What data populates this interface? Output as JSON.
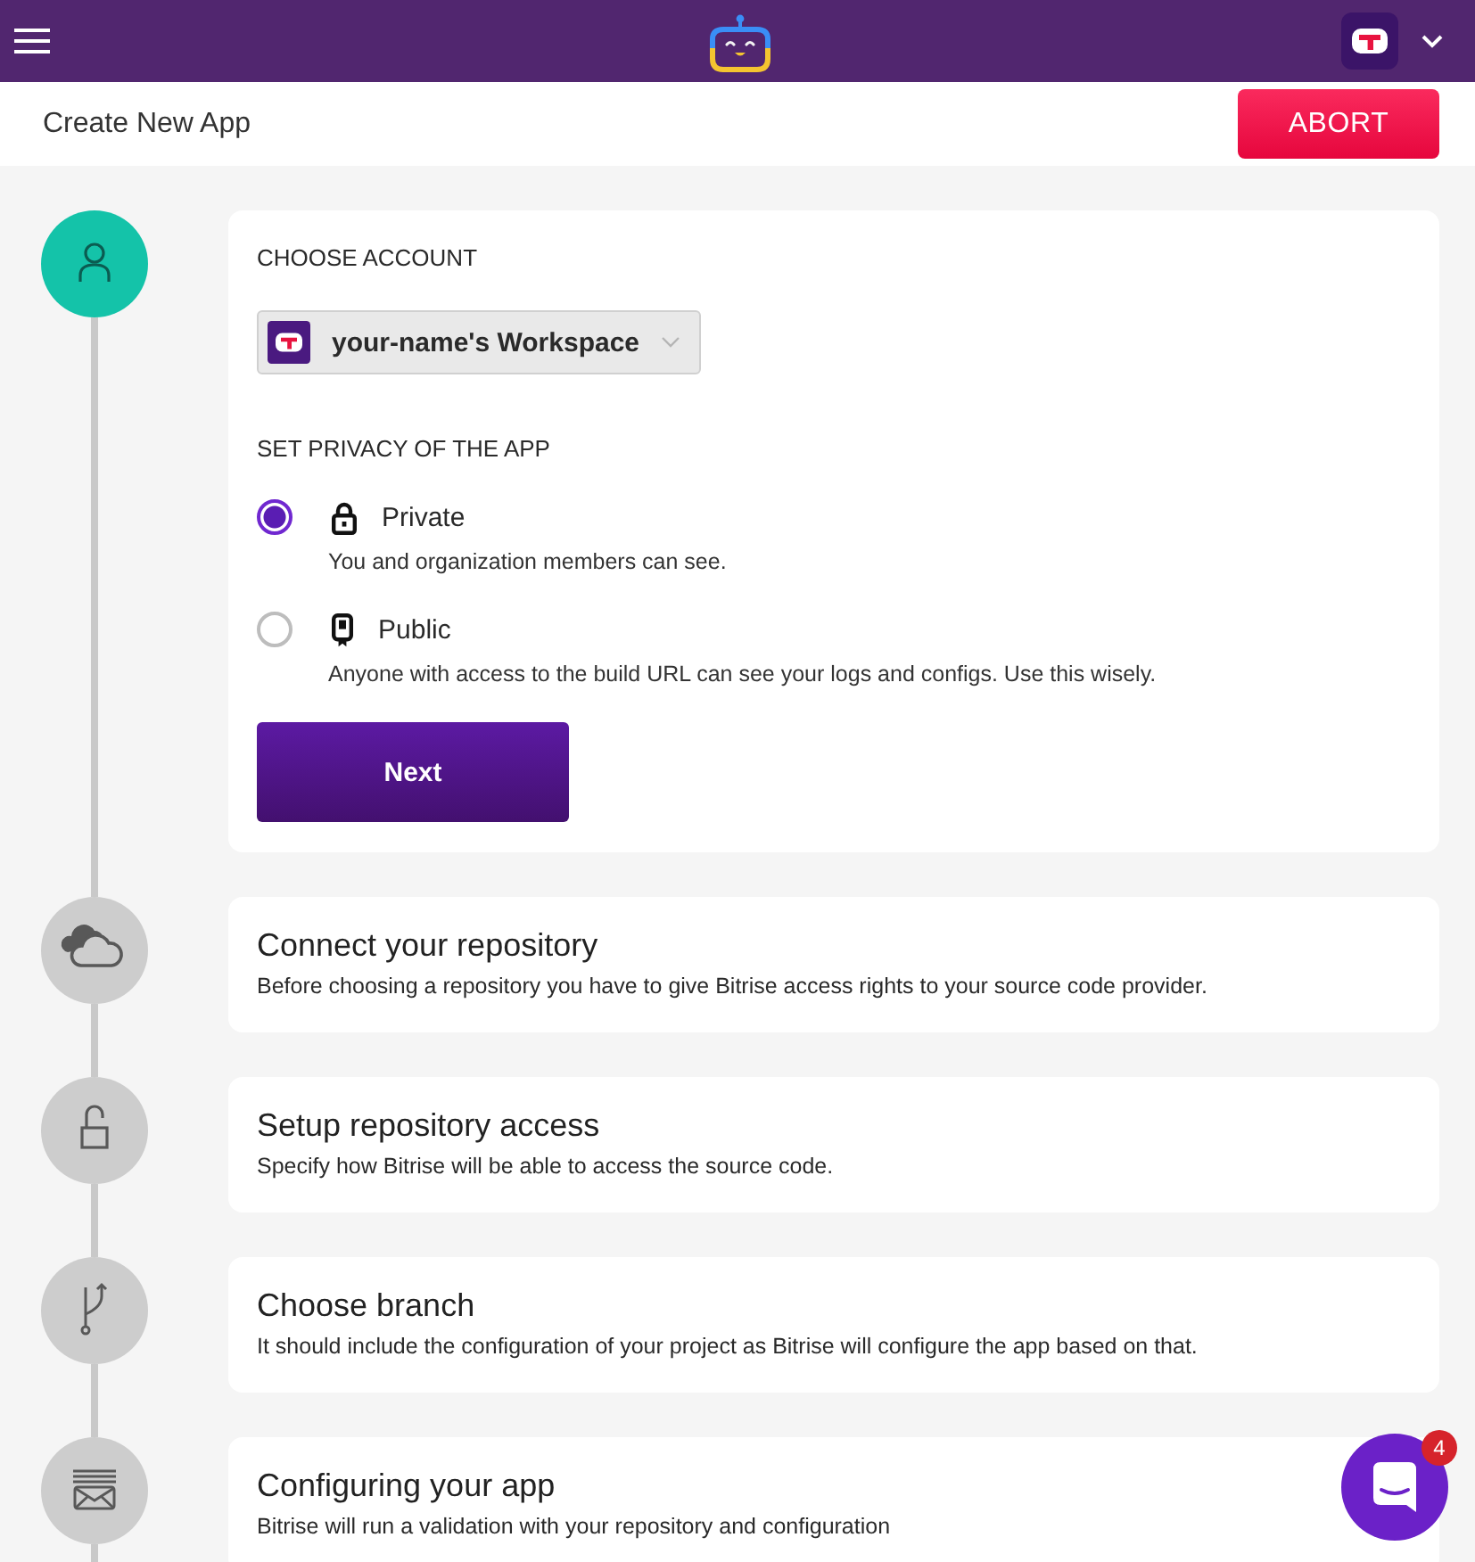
{
  "header": {
    "title": "Create New App",
    "abort_button": "ABORT"
  },
  "steps": [
    {
      "kind": "account",
      "active": true,
      "account_label": "CHOOSE ACCOUNT",
      "workspace": "your-name's Workspace",
      "privacy_label": "SET PRIVACY OF THE APP",
      "privacy_options": [
        {
          "kind": "private",
          "label": "Private",
          "description": "You and organization members can see.",
          "selected": true
        },
        {
          "kind": "public",
          "label": "Public",
          "description": "Anyone with access to the build URL can see your logs and configs. Use this wisely.",
          "selected": false
        }
      ],
      "next_button": "Next"
    },
    {
      "kind": "repository",
      "active": false,
      "title": "Connect your repository",
      "description": "Before choosing a repository you have to give Bitrise access rights to your source code provider."
    },
    {
      "kind": "access",
      "active": false,
      "title": "Setup repository access",
      "description": "Specify how Bitrise will be able to access the source code."
    },
    {
      "kind": "branch",
      "active": false,
      "title": "Choose branch",
      "description": "It should include the configuration of your project as Bitrise will configure the app based on that."
    },
    {
      "kind": "configuration",
      "active": false,
      "title": "Configuring your app",
      "description": "Bitrise will run a validation with your repository and configuration"
    }
  ],
  "chat": {
    "unread_count": "4"
  }
}
